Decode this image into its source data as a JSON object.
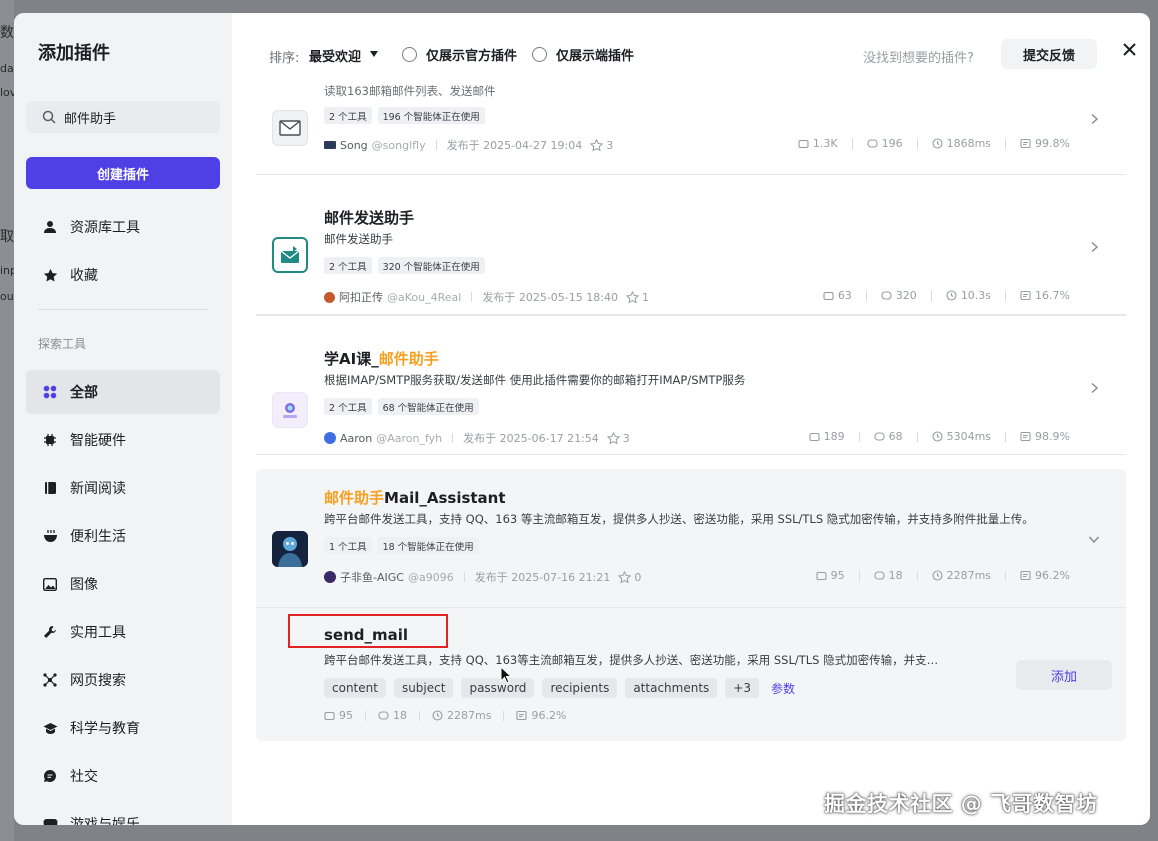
{
  "sidebar": {
    "title": "添加插件",
    "search_value": "邮件助手",
    "create_label": "创建插件",
    "top_items": [
      {
        "label": "资源库工具"
      },
      {
        "label": "收藏"
      }
    ],
    "section_label": "探索工具",
    "categories": [
      {
        "label": "全部",
        "active": true
      },
      {
        "label": "智能硬件"
      },
      {
        "label": "新闻阅读"
      },
      {
        "label": "便利生活"
      },
      {
        "label": "图像"
      },
      {
        "label": "实用工具"
      },
      {
        "label": "网页搜索"
      },
      {
        "label": "科学与教育"
      },
      {
        "label": "社交"
      },
      {
        "label": "游戏与娱乐"
      }
    ]
  },
  "topbar": {
    "sort_label": "排序:",
    "sort_value": "最受欢迎",
    "filter_official": "仅展示官方插件",
    "filter_client": "仅展示端插件",
    "not_found": "没找到想要的插件?",
    "feedback": "提交反馈"
  },
  "plugins": [
    {
      "desc_partial": "读取163邮箱邮件列表、发送邮件",
      "tags": [
        "2 个工具",
        "196 个智能体正在使用"
      ],
      "author": "Song",
      "handle": "@songlfly",
      "published": "发布于 2025-04-27 19:04",
      "stars": "3",
      "stats": [
        "1.3K",
        "196",
        "1868ms",
        "99.8%"
      ]
    },
    {
      "name": "邮件发送助手",
      "desc": "邮件发送助手",
      "tags": [
        "2 个工具",
        "320 个智能体正在使用"
      ],
      "author": "阿扣正传",
      "handle": "@aKou_4Real",
      "published": "发布于 2025-05-15 18:40",
      "stars": "1",
      "stats": [
        "63",
        "320",
        "10.3s",
        "16.7%"
      ]
    },
    {
      "name_prefix": "学AI课_",
      "name_highlight": "邮件助手",
      "desc": "根据IMAP/SMTP服务获取/发送邮件 使用此插件需要你的邮箱打开IMAP/SMTP服务",
      "tags": [
        "2 个工具",
        "68 个智能体正在使用"
      ],
      "author": "Aaron",
      "handle": "@Aaron_fyh",
      "published": "发布于 2025-06-17 21:54",
      "stars": "3",
      "stats": [
        "189",
        "68",
        "5304ms",
        "98.9%"
      ]
    },
    {
      "name_highlight": "邮件助手",
      "name_suffix": "Mail_Assistant",
      "desc": "跨平台邮件发送工具，支持 QQ、163 等主流邮箱互发，提供多人抄送、密送功能，采用 SSL/TLS 隐式加密传输，并支持多附件批量上传。",
      "tags": [
        "1 个工具",
        "18 个智能体正在使用"
      ],
      "author": "子非鱼-AIGC",
      "handle": "@a9096",
      "published": "发布于 2025-07-16 21:21",
      "stars": "0",
      "stats": [
        "95",
        "18",
        "2287ms",
        "96.2%"
      ]
    }
  ],
  "tool": {
    "name": "send_mail",
    "desc": "跨平台邮件发送工具，支持 QQ、163等主流邮箱互发，提供多人抄送、密送功能，采用 SSL/TLS 隐式加密传输，并支…",
    "params": [
      "content",
      "subject",
      "password",
      "recipients",
      "attachments",
      "+3"
    ],
    "params_link": "参数",
    "stats": [
      "95",
      "18",
      "2287ms",
      "96.2%"
    ],
    "add_label": "添加"
  },
  "watermark": "掘金技术社区 @ 飞哥数智坊",
  "backdrop_text": [
    "数",
    "dat",
    "lov",
    "取",
    "inp",
    "out"
  ],
  "colors": {
    "accent": "#4e40e5",
    "highlight": "#f6a021",
    "annotation": "#e02424"
  }
}
